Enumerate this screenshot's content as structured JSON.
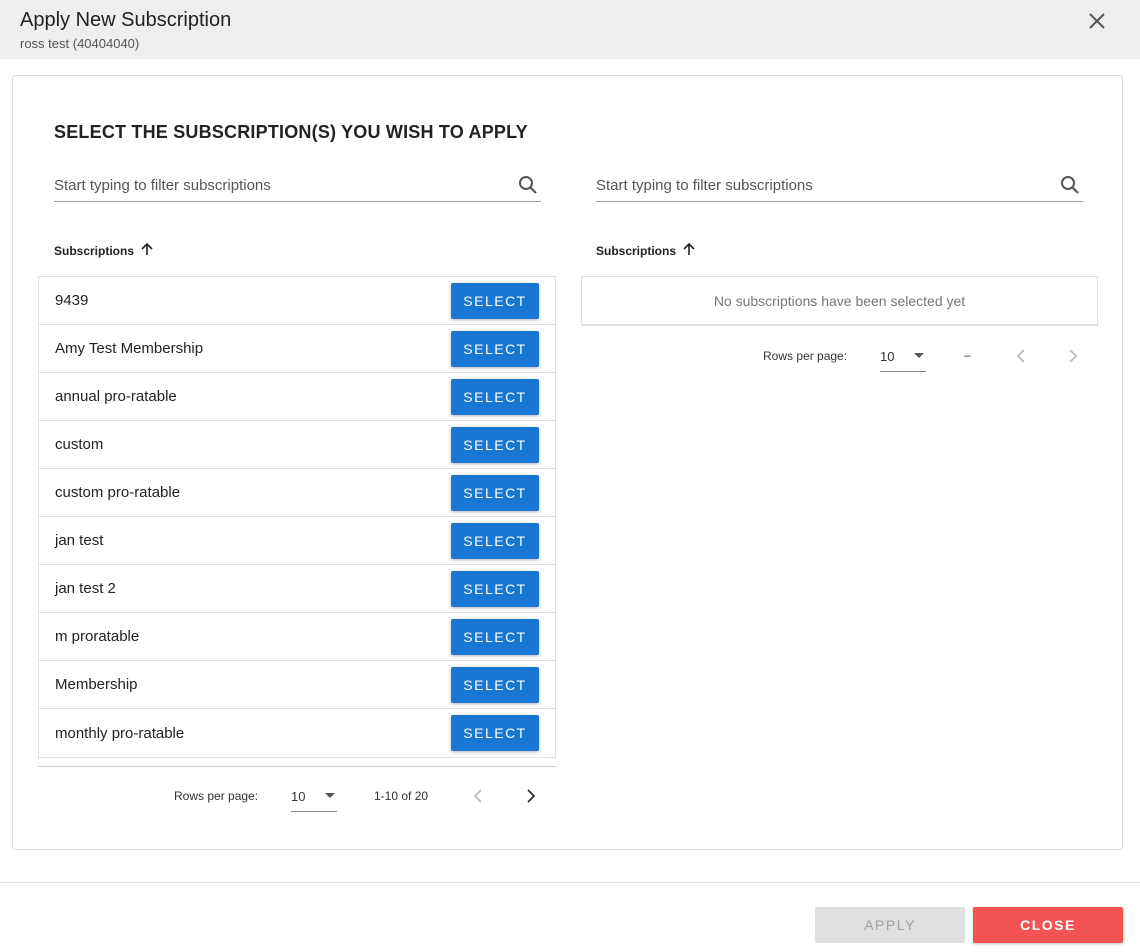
{
  "dialog": {
    "title": "Apply New Subscription",
    "subtitle": "ross test (40404040)",
    "close_icon": "close-icon"
  },
  "main": {
    "heading": "SELECT THE SUBSCRIPTION(S) YOU WISH TO APPLY"
  },
  "left": {
    "filter_placeholder": "Start typing to filter subscriptions",
    "column_header": "Subscriptions",
    "sort_icon": "arrow-up-icon",
    "rows": [
      {
        "name": "9439",
        "button": "SELECT"
      },
      {
        "name": "Amy Test Membership",
        "button": "SELECT"
      },
      {
        "name": "annual pro-ratable",
        "button": "SELECT"
      },
      {
        "name": "custom",
        "button": "SELECT"
      },
      {
        "name": "custom pro-ratable",
        "button": "SELECT"
      },
      {
        "name": "jan test",
        "button": "SELECT"
      },
      {
        "name": "jan test 2",
        "button": "SELECT"
      },
      {
        "name": "m proratable",
        "button": "SELECT"
      },
      {
        "name": "Membership",
        "button": "SELECT"
      },
      {
        "name": "monthly pro-ratable",
        "button": "SELECT"
      }
    ],
    "pagination": {
      "rows_per_page_label": "Rows per page:",
      "rows_per_page_value": "10",
      "range": "1-10 of 20"
    }
  },
  "right": {
    "filter_placeholder": "Start typing to filter subscriptions",
    "column_header": "Subscriptions",
    "empty_message": "No subscriptions have been selected yet",
    "pagination": {
      "rows_per_page_label": "Rows per page:",
      "rows_per_page_value": "10",
      "range": "–"
    }
  },
  "footer": {
    "apply_label": "APPLY",
    "close_label": "CLOSE"
  },
  "colors": {
    "primary": "#1976d2",
    "danger": "#f25454",
    "header_bg": "#eeeeee",
    "disabled_bg": "#e0e0e0"
  }
}
